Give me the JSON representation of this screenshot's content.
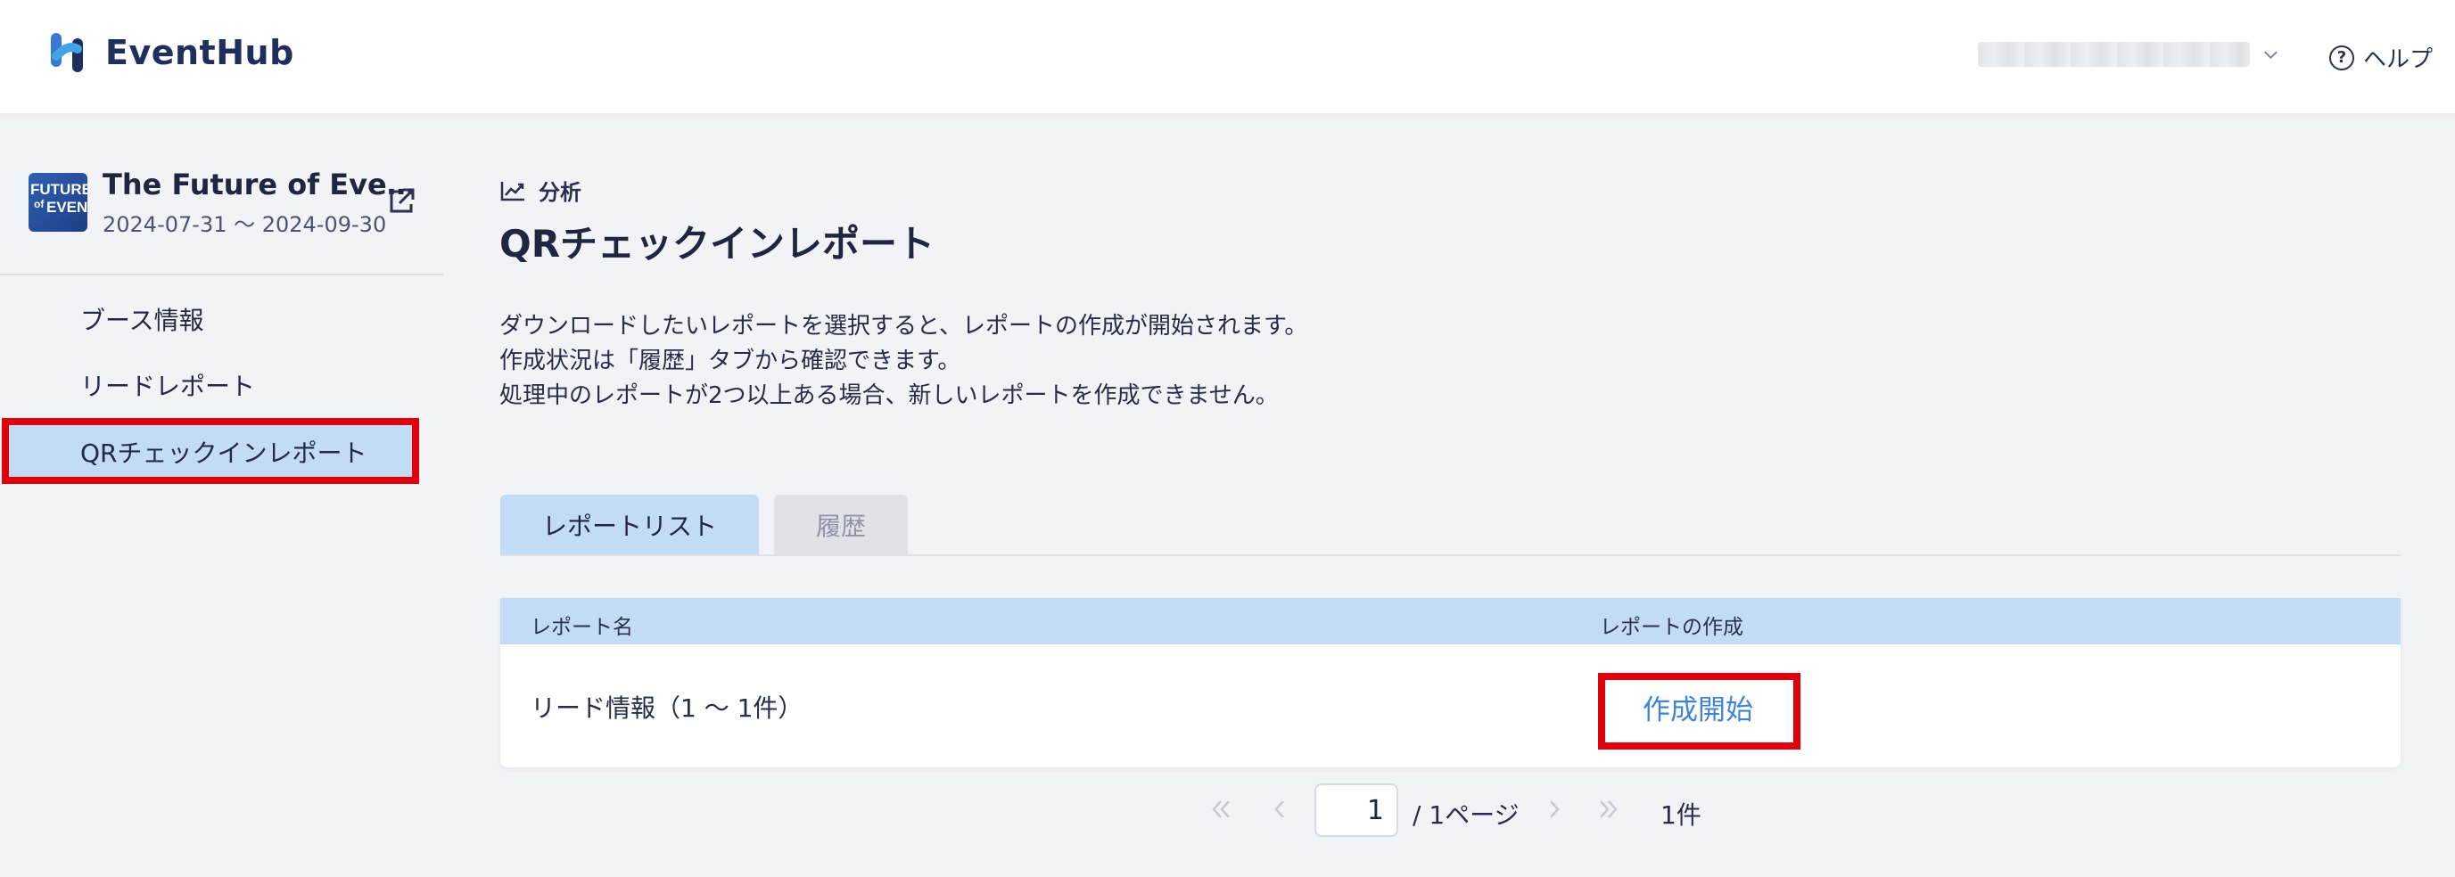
{
  "app": {
    "name": "EventHub"
  },
  "header": {
    "account_label": "",
    "help_label": "ヘルプ"
  },
  "event": {
    "thumbnail_lines": [
      "FUTURE",
      "of",
      "EVENTS"
    ],
    "title": "The Future of Eve…",
    "dates": "2024-07-31 〜 2024-09-30"
  },
  "sidebar": {
    "items": [
      {
        "label": "ブース情報",
        "active": false
      },
      {
        "label": "リードレポート",
        "active": false
      },
      {
        "label": "QRチェックインレポート",
        "active": true
      }
    ]
  },
  "breadcrumb": {
    "label": "分析"
  },
  "page": {
    "title": "QRチェックインレポート",
    "description": [
      "ダウンロードしたいレポートを選択すると、レポートの作成が開始されます。",
      "作成状況は「履歴」タブから確認できます。",
      "処理中のレポートが2つ以上ある場合、新しいレポートを作成できません。"
    ]
  },
  "tabs": [
    {
      "label": "レポートリスト",
      "active": true
    },
    {
      "label": "履歴",
      "active": false
    }
  ],
  "table": {
    "headers": [
      "レポート名",
      "レポートの作成"
    ],
    "rows": [
      {
        "name": "リード情報（1 〜 1件）",
        "action": "作成開始"
      }
    ]
  },
  "pagination": {
    "current_page": "1",
    "total_pages_label": "/ 1ページ",
    "count_label": "1件"
  },
  "colors": {
    "accent_blue": "#3f84d6",
    "selected_bg": "#c3dcf5",
    "highlight_red": "#e0000c",
    "brand_navy": "#1f2e5c"
  }
}
